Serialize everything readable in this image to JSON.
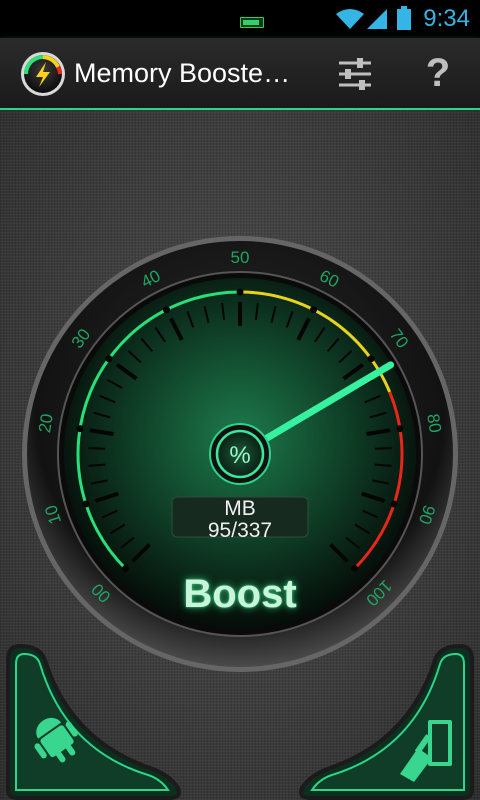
{
  "status_bar": {
    "time": "9:34"
  },
  "app_bar": {
    "title": "Memory Booste…",
    "icons": [
      "lightning-icon",
      "sliders-icon",
      "help-icon"
    ],
    "help_label": "?"
  },
  "gauge": {
    "scale_labels": [
      "00",
      "10",
      "20",
      "30",
      "40",
      "50",
      "60",
      "70",
      "80",
      "90",
      "100"
    ],
    "unit_label": "MB",
    "value_text": "95/337",
    "center_symbol": "%",
    "needle_value": 72,
    "zone_colors": {
      "normal": "#27e07a",
      "warning": "#e8d21a",
      "danger": "#e8261a"
    }
  },
  "boost_button": {
    "label": "Boost"
  },
  "corner_buttons": [
    {
      "icon": "android-icon"
    },
    {
      "icon": "broom-clean-icon"
    }
  ],
  "colors": {
    "accent": "#2bd58a",
    "status_blue": "#35b5e5"
  }
}
